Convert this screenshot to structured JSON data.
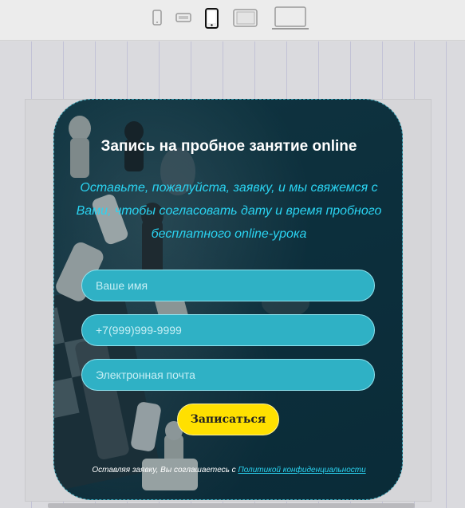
{
  "toolbar": {
    "devices": [
      {
        "icon": "phone-small-icon",
        "selected": false
      },
      {
        "icon": "phone-landscape-icon",
        "selected": false
      },
      {
        "icon": "phone-icon",
        "selected": true
      },
      {
        "icon": "tablet-landscape-icon",
        "selected": false
      },
      {
        "icon": "laptop-icon",
        "selected": false
      }
    ]
  },
  "form": {
    "title": "Запись на пробное занятие online",
    "subtitle": "Оставьте, пожалуйста, заявку, и мы свяжемся с Вами, чтобы согласовать дату и время пробного бесплатного online-урока",
    "name_placeholder": "Ваше имя",
    "phone_placeholder": "+7(999)999-9999",
    "email_placeholder": "Электронная почта",
    "submit_label": "Записаться",
    "consent_text": "Оставляя заявку, Вы соглашаетесь с ",
    "consent_link": "Политикой конфиденциальности"
  },
  "colors": {
    "accent": "#2ad4f2",
    "button": "#ffe000",
    "field": "#2fb1c5",
    "card": "#0f3341"
  }
}
